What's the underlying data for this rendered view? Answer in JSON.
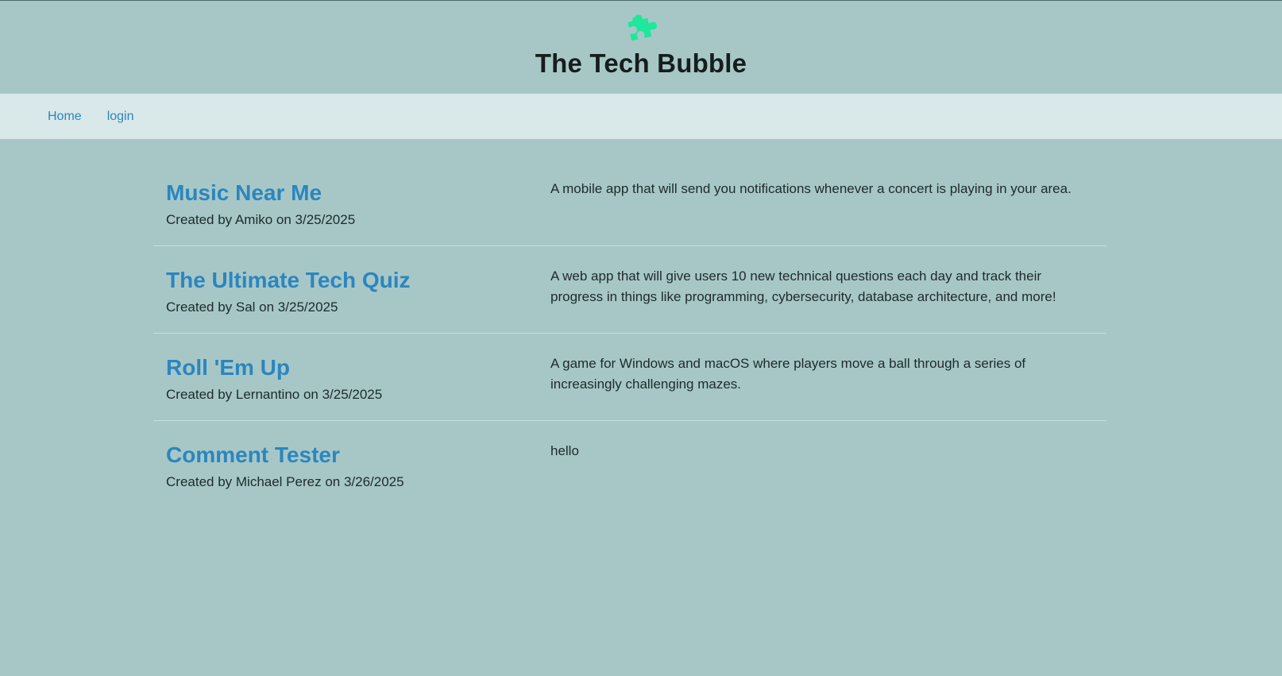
{
  "header": {
    "logo_icon": "puzzle-piece-icon",
    "logo_color": "#1fe79b",
    "title": "The Tech Bubble"
  },
  "nav": {
    "home_label": "Home",
    "login_label": "login"
  },
  "projects": [
    {
      "title": "Music Near Me",
      "meta": "Created by Amiko on 3/25/2025",
      "description": "A mobile app that will send you notifications whenever a concert is playing in your area."
    },
    {
      "title": "The Ultimate Tech Quiz",
      "meta": "Created by Sal on 3/25/2025",
      "description": "A web app that will give users 10 new technical questions each day and track their progress in things like programming, cybersecurity, database architecture, and more!"
    },
    {
      "title": "Roll 'Em Up",
      "meta": "Created by Lernantino on 3/25/2025",
      "description": "A game for Windows and macOS where players move a ball through a series of increasingly challenging mazes."
    },
    {
      "title": "Comment Tester",
      "meta": "Created by Michael Perez on 3/26/2025",
      "description": "hello"
    }
  ],
  "colors": {
    "background": "#a7c7c7",
    "nav_background": "#d9e8e8",
    "link": "#2b86be"
  }
}
